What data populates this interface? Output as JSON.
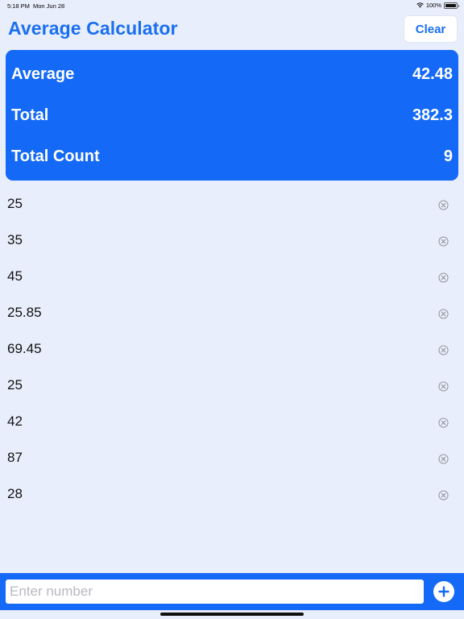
{
  "status_bar": {
    "time": "5:18 PM",
    "date": "Mon Jun 28",
    "battery": "100%"
  },
  "header": {
    "title": "Average Calculator",
    "clear_label": "Clear"
  },
  "summary": {
    "average_label": "Average",
    "average_value": "42.48",
    "total_label": "Total",
    "total_value": "382.3",
    "count_label": "Total Count",
    "count_value": "9"
  },
  "numbers": [
    "25",
    "35",
    "45",
    "25.85",
    "69.45",
    "25",
    "42",
    "87",
    "28"
  ],
  "input": {
    "placeholder": "Enter number",
    "value": ""
  },
  "colors": {
    "accent": "#1469f7",
    "title": "#1a6ff0",
    "background": "#e8eefb"
  },
  "icons": {
    "remove": "circle-x-icon",
    "add": "plus-circle-icon"
  }
}
